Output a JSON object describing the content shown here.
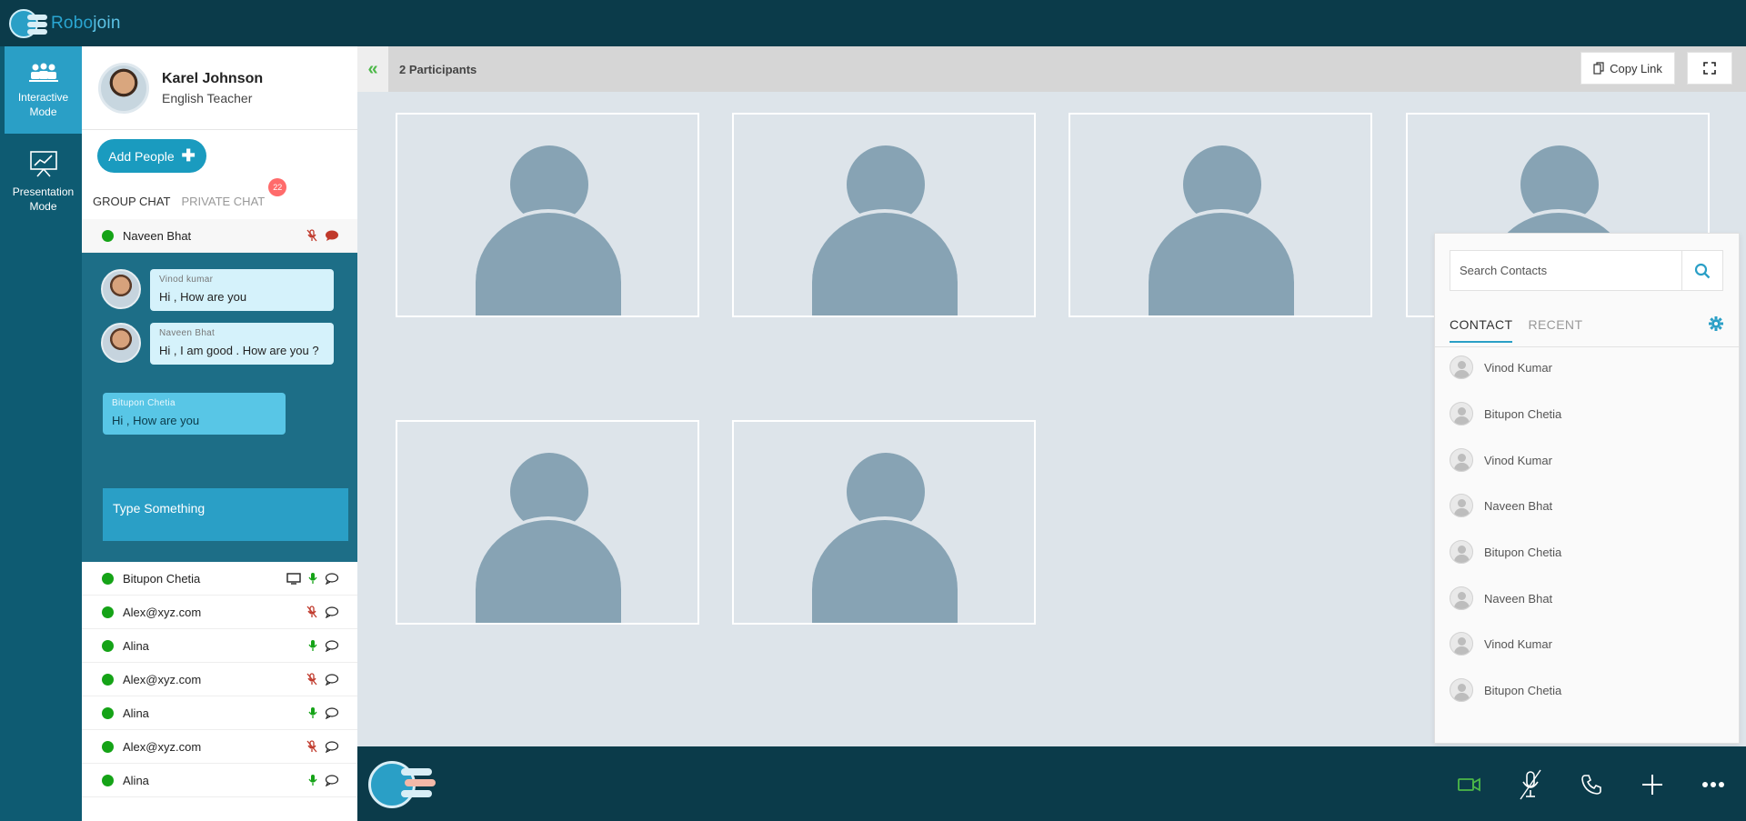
{
  "app": {
    "logo_text_a": "Robo",
    "logo_text_b": "join"
  },
  "leftnav": {
    "interactive_label": "Interactive Mode",
    "presentation_label": "Presentation Mode"
  },
  "profile": {
    "name": "Karel Johnson",
    "role": "English Teacher"
  },
  "add_people_label": "Add People",
  "chat_tabs": {
    "group": "GROUP CHAT",
    "private": "PRIVATE CHAT",
    "private_badge": "22"
  },
  "active_participant": "Naveen Bhat",
  "messages": [
    {
      "sender": "Vinod kumar",
      "text": "Hi , How are you"
    },
    {
      "sender": "Naveen Bhat",
      "text": "Hi , I am good . How are you ?"
    },
    {
      "sender": "Bitupon Chetia",
      "text": "Hi , How are you"
    }
  ],
  "type_placeholder": "Type Something",
  "participants": [
    {
      "name": "Bitupon Chetia"
    },
    {
      "name": "Alex@xyz.com"
    },
    {
      "name": "Alina"
    },
    {
      "name": "Alex@xyz.com"
    },
    {
      "name": "Alina"
    },
    {
      "name": "Alex@xyz.com"
    },
    {
      "name": "Alina"
    }
  ],
  "main": {
    "participants_count": "2 Participants",
    "copy_link_label": "Copy Link"
  },
  "contacts": {
    "search_placeholder": "Search Contacts",
    "tab_contact": "CONTACT",
    "tab_recent": "RECENT",
    "items": [
      "Vinod Kumar",
      "Bitupon Chetia",
      "Vinod Kumar",
      "Naveen Bhat",
      "Bitupon Chetia",
      "Naveen Bhat",
      "Vinod Kumar",
      "Bitupon Chetia"
    ]
  },
  "colors": {
    "dark": "#0b3b4a",
    "accent": "#2a9fc6",
    "online": "#15a317",
    "muted_red": "#c0392b",
    "video_green": "#4cb848"
  }
}
